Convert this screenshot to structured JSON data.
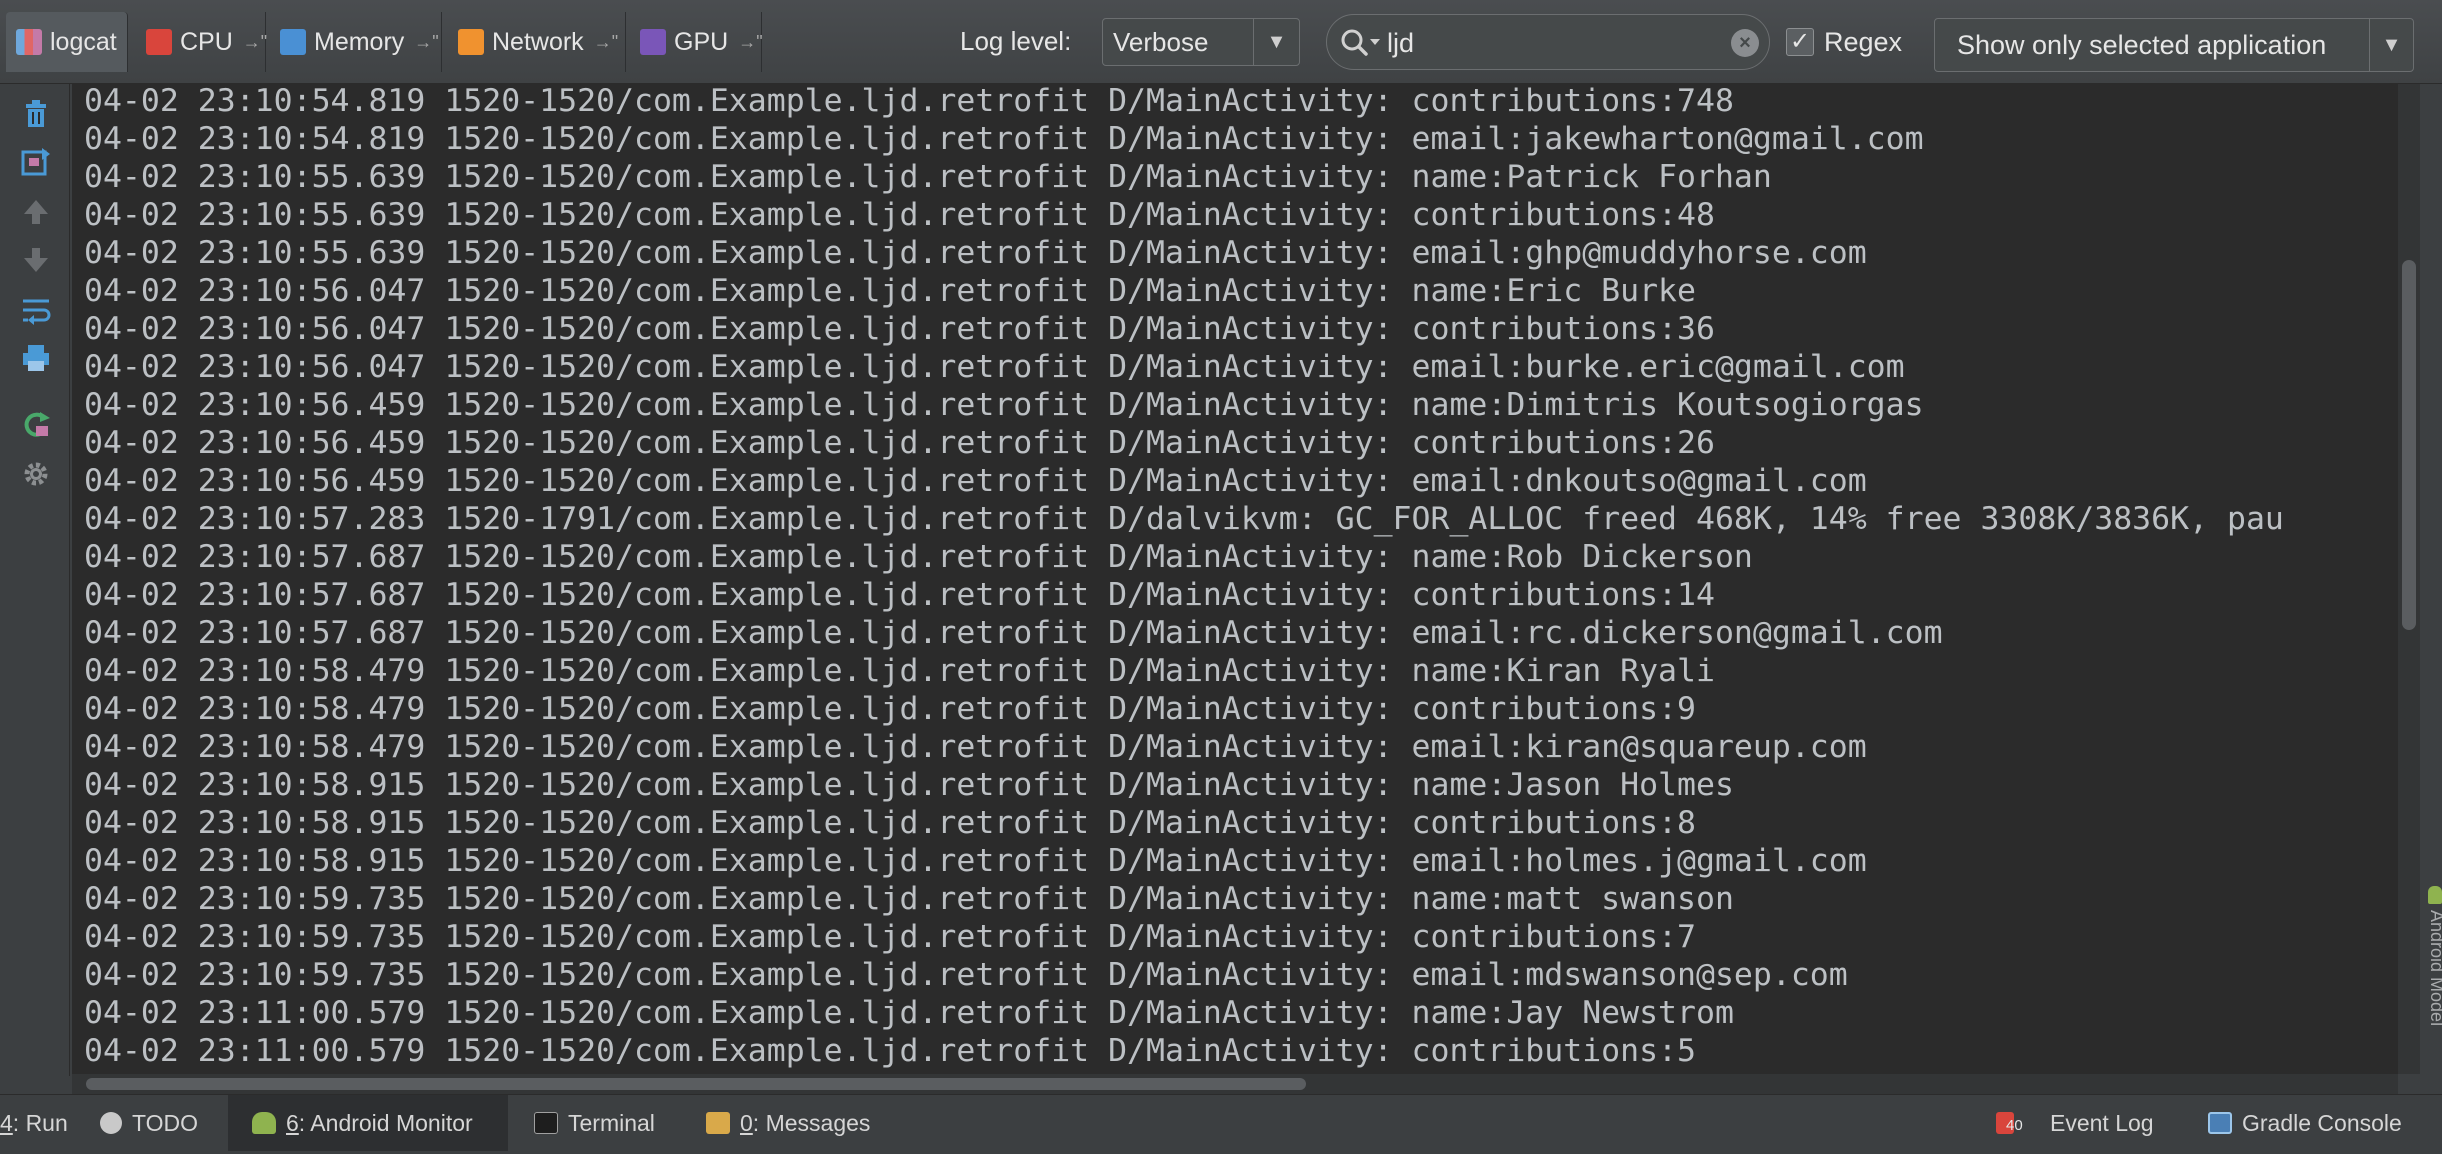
{
  "toolbar": {
    "tabs": [
      {
        "label": "logcat",
        "icon": "logcat-icon",
        "color": "#c47aa8"
      },
      {
        "label": "CPU",
        "icon": "cpu-icon",
        "color": "#d9453c",
        "pin": "→\""
      },
      {
        "label": "Memory",
        "icon": "memory-icon",
        "color": "#4a90d4",
        "pin": "→\""
      },
      {
        "label": "Network",
        "icon": "network-icon",
        "color": "#f0922f",
        "pin": "→\""
      },
      {
        "label": "GPU",
        "icon": "gpu-icon",
        "color": "#7a56b8",
        "pin": "→\""
      }
    ],
    "log_level_label": "Log level:",
    "log_level_value": "Verbose",
    "search_value": "ljd",
    "regex_label": "Regex",
    "regex_checked": "✓",
    "app_filter_value": "Show only selected application"
  },
  "log_lines": [
    "04-02 23:10:54.819 1520-1520/com.Example.ljd.retrofit D/MainActivity: contributions:748",
    "04-02 23:10:54.819 1520-1520/com.Example.ljd.retrofit D/MainActivity: email:jakewharton@gmail.com",
    "04-02 23:10:55.639 1520-1520/com.Example.ljd.retrofit D/MainActivity: name:Patrick Forhan",
    "04-02 23:10:55.639 1520-1520/com.Example.ljd.retrofit D/MainActivity: contributions:48",
    "04-02 23:10:55.639 1520-1520/com.Example.ljd.retrofit D/MainActivity: email:ghp@muddyhorse.com",
    "04-02 23:10:56.047 1520-1520/com.Example.ljd.retrofit D/MainActivity: name:Eric Burke",
    "04-02 23:10:56.047 1520-1520/com.Example.ljd.retrofit D/MainActivity: contributions:36",
    "04-02 23:10:56.047 1520-1520/com.Example.ljd.retrofit D/MainActivity: email:burke.eric@gmail.com",
    "04-02 23:10:56.459 1520-1520/com.Example.ljd.retrofit D/MainActivity: name:Dimitris Koutsogiorgas",
    "04-02 23:10:56.459 1520-1520/com.Example.ljd.retrofit D/MainActivity: contributions:26",
    "04-02 23:10:56.459 1520-1520/com.Example.ljd.retrofit D/MainActivity: email:dnkoutso@gmail.com",
    "04-02 23:10:57.283 1520-1791/com.Example.ljd.retrofit D/dalvikvm: GC_FOR_ALLOC freed 468K, 14% free 3308K/3836K, pau",
    "04-02 23:10:57.687 1520-1520/com.Example.ljd.retrofit D/MainActivity: name:Rob Dickerson",
    "04-02 23:10:57.687 1520-1520/com.Example.ljd.retrofit D/MainActivity: contributions:14",
    "04-02 23:10:57.687 1520-1520/com.Example.ljd.retrofit D/MainActivity: email:rc.dickerson@gmail.com",
    "04-02 23:10:58.479 1520-1520/com.Example.ljd.retrofit D/MainActivity: name:Kiran Ryali",
    "04-02 23:10:58.479 1520-1520/com.Example.ljd.retrofit D/MainActivity: contributions:9",
    "04-02 23:10:58.479 1520-1520/com.Example.ljd.retrofit D/MainActivity: email:kiran@squareup.com",
    "04-02 23:10:58.915 1520-1520/com.Example.ljd.retrofit D/MainActivity: name:Jason Holmes",
    "04-02 23:10:58.915 1520-1520/com.Example.ljd.retrofit D/MainActivity: contributions:8",
    "04-02 23:10:58.915 1520-1520/com.Example.ljd.retrofit D/MainActivity: email:holmes.j@gmail.com",
    "04-02 23:10:59.735 1520-1520/com.Example.ljd.retrofit D/MainActivity: name:matt swanson",
    "04-02 23:10:59.735 1520-1520/com.Example.ljd.retrofit D/MainActivity: contributions:7",
    "04-02 23:10:59.735 1520-1520/com.Example.ljd.retrofit D/MainActivity: email:mdswanson@sep.com",
    "04-02 23:11:00.579 1520-1520/com.Example.ljd.retrofit D/MainActivity: name:Jay Newstrom",
    "04-02 23:11:00.579 1520-1520/com.Example.ljd.retrofit D/MainActivity: contributions:5"
  ],
  "side_tools": [
    "trash-icon",
    "restart-icon",
    "up-arrow-icon",
    "down-arrow-icon",
    "soft-wrap-icon",
    "print-icon",
    "refresh-icon",
    "settings-gear-icon"
  ],
  "bottom": {
    "run": {
      "num": "4",
      "label": ": Run"
    },
    "todo": "TODO",
    "android_monitor": {
      "num": "6",
      "label": ": Android Monitor"
    },
    "terminal": "Terminal",
    "messages": {
      "num": "0",
      "label": ": Messages"
    },
    "event_badge": "40",
    "event_log": "Event Log",
    "gradle_console": "Gradle Console"
  },
  "right_edge_label": "Android Model",
  "colors": {
    "log_text": "#bcc0c4",
    "log_bg": "#2b2b2b",
    "panel_bg": "#3c3f41"
  }
}
